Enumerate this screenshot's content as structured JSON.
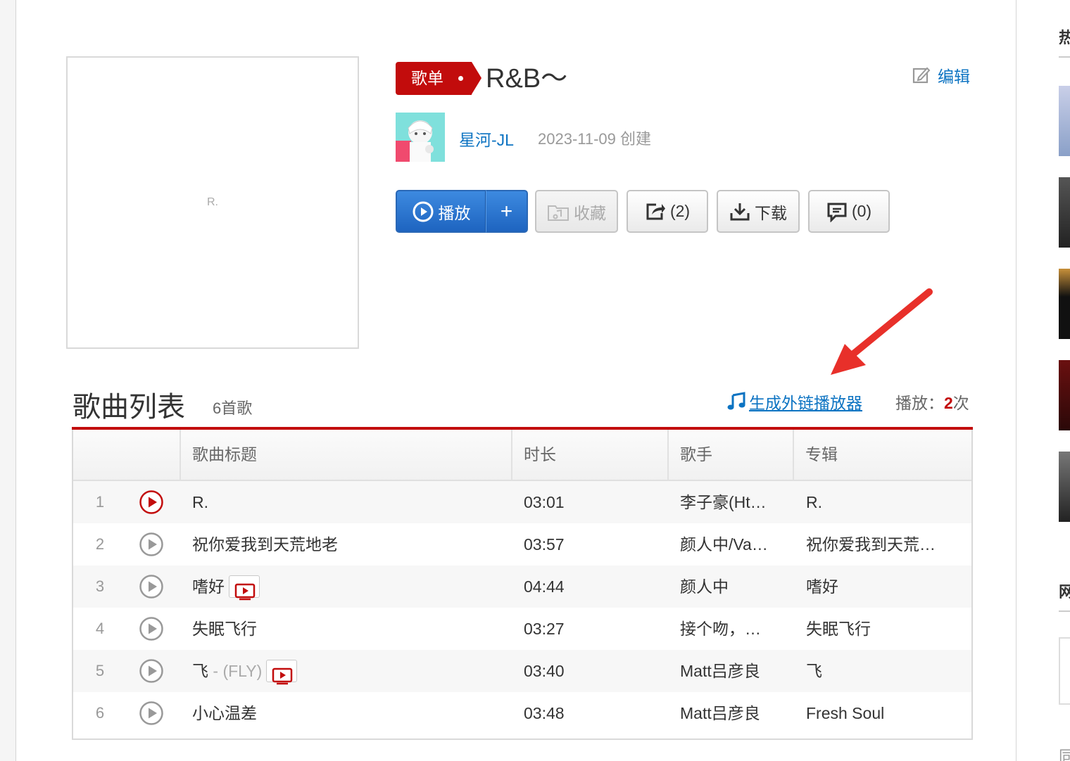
{
  "playlist": {
    "cover_text": "R.",
    "tag": "歌单",
    "title": "R&B～",
    "edit_label": "编辑",
    "creator": "星河-JL",
    "created": "2023-11-09 创建"
  },
  "actions": {
    "play": "播放",
    "add": "+",
    "favorite": "收藏",
    "share": "(2)",
    "download": "下载",
    "comment": "(0)"
  },
  "list": {
    "title": "歌曲列表",
    "count": "6首歌",
    "outchain": "生成外链播放器",
    "play_count_prefix": "播放：",
    "play_count": "2",
    "play_count_suffix": "次",
    "headers": [
      "歌曲标题",
      "时长",
      "歌手",
      "专辑"
    ],
    "songs": [
      {
        "num": "1",
        "title": "R.",
        "alias": "",
        "mv": false,
        "duration": "03:01",
        "artist": "李子豪(Ht…",
        "album": "R."
      },
      {
        "num": "2",
        "title": "祝你爱我到天荒地老",
        "alias": "",
        "mv": false,
        "duration": "03:57",
        "artist": "颜人中/Va…",
        "album": "祝你爱我到天荒…"
      },
      {
        "num": "3",
        "title": "嗜好",
        "alias": "",
        "mv": true,
        "duration": "04:44",
        "artist": "颜人中",
        "album": "嗜好"
      },
      {
        "num": "4",
        "title": "失眠飞行",
        "alias": "",
        "mv": false,
        "duration": "03:27",
        "artist": "接个吻，…",
        "album": "失眠飞行"
      },
      {
        "num": "5",
        "title": "飞",
        "alias": " - (FLY)",
        "mv": true,
        "duration": "03:40",
        "artist": "Matt吕彦良",
        "album": "飞"
      },
      {
        "num": "6",
        "title": "小心温差",
        "alias": "",
        "mv": false,
        "duration": "03:48",
        "artist": "Matt吕彦良",
        "album": "Fresh Soul"
      }
    ]
  },
  "sidebar": {
    "heading_1": "热",
    "heading_2": "网",
    "heading_3": "同"
  },
  "colors": {
    "brand_red": "#c20c0c",
    "link_blue": "#0c73c2",
    "play_blue": "#2a6fd0"
  }
}
